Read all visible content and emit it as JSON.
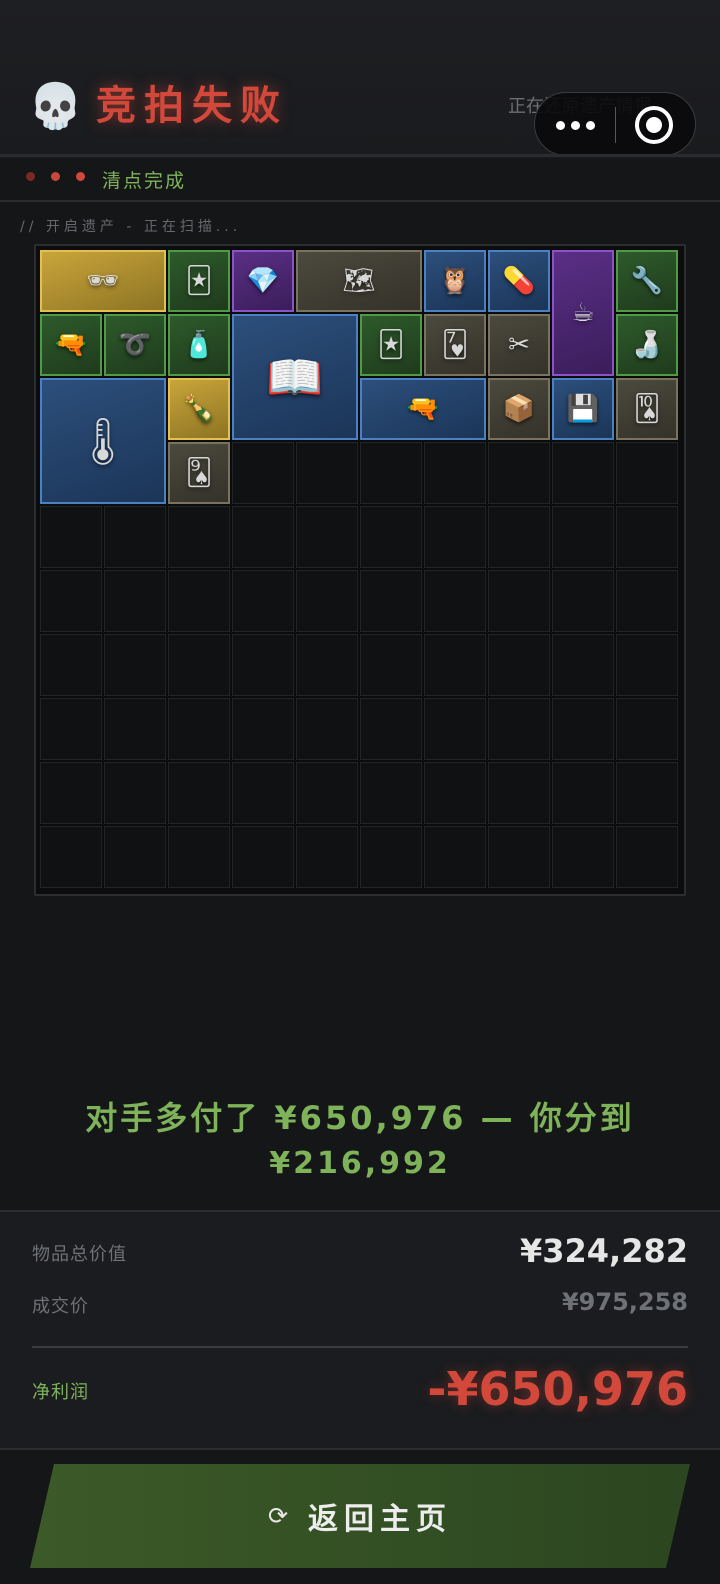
{
  "header": {
    "skull_icon": "skull-icon",
    "title": "竞拍失败",
    "restore_status": "正在还原遗产情报...",
    "title_color": "#d2483a"
  },
  "progress": {
    "dot_colors": [
      "#7a2a22",
      "#c8493a",
      "#d2483a"
    ],
    "label": "清点完成",
    "scan_text": "// 开启遗产 - 正在扫描..."
  },
  "grid": {
    "columns": 10,
    "rows": 10,
    "items": [
      {
        "name": "sunglasses",
        "rarity": "gold",
        "icon": "🕶",
        "col": 0,
        "row": 0,
        "w": 2,
        "h": 1
      },
      {
        "name": "good-luck-card",
        "rarity": "green",
        "icon": "🃏",
        "col": 2,
        "row": 0,
        "w": 1,
        "h": 1
      },
      {
        "name": "crystal-earring",
        "rarity": "purple",
        "icon": "💎",
        "col": 3,
        "row": 0,
        "w": 1,
        "h": 1
      },
      {
        "name": "old-map",
        "rarity": "gray",
        "icon": "🗺",
        "col": 4,
        "row": 0,
        "w": 2,
        "h": 1
      },
      {
        "name": "wooden-bird",
        "rarity": "blue",
        "icon": "🦉",
        "col": 6,
        "row": 0,
        "w": 1,
        "h": 1
      },
      {
        "name": "pill-strip",
        "rarity": "blue",
        "icon": "💊",
        "col": 7,
        "row": 0,
        "w": 1,
        "h": 1
      },
      {
        "name": "coffee-bag",
        "rarity": "purple",
        "icon": "☕",
        "col": 8,
        "row": 0,
        "w": 1,
        "h": 2
      },
      {
        "name": "wrench",
        "rarity": "green",
        "icon": "🔧",
        "col": 9,
        "row": 0,
        "w": 1,
        "h": 1
      },
      {
        "name": "bullet",
        "rarity": "green",
        "icon": "🔫",
        "col": 0,
        "row": 1,
        "w": 1,
        "h": 1
      },
      {
        "name": "hose",
        "rarity": "green",
        "icon": "➰",
        "col": 1,
        "row": 1,
        "w": 1,
        "h": 1
      },
      {
        "name": "medicine-bottle",
        "rarity": "green",
        "icon": "🧴",
        "col": 2,
        "row": 1,
        "w": 1,
        "h": 1
      },
      {
        "name": "magazine",
        "rarity": "blue",
        "icon": "📖",
        "col": 3,
        "row": 1,
        "w": 2,
        "h": 2
      },
      {
        "name": "good-luck-card-2",
        "rarity": "green",
        "icon": "🃏",
        "col": 5,
        "row": 1,
        "w": 1,
        "h": 1
      },
      {
        "name": "playing-card-hearts",
        "rarity": "gray",
        "icon": "🂷",
        "col": 6,
        "row": 1,
        "w": 1,
        "h": 1
      },
      {
        "name": "forceps",
        "rarity": "gray",
        "icon": "✂",
        "col": 7,
        "row": 1,
        "w": 1,
        "h": 1
      },
      {
        "name": "small-tray",
        "rarity": "green",
        "icon": "🍶",
        "col": 9,
        "row": 1,
        "w": 1,
        "h": 1
      },
      {
        "name": "digital-thermometer",
        "rarity": "blue",
        "icon": "🌡",
        "col": 0,
        "row": 2,
        "w": 2,
        "h": 2
      },
      {
        "name": "drink-bottle",
        "rarity": "gold",
        "icon": "🍾",
        "col": 2,
        "row": 2,
        "w": 1,
        "h": 1
      },
      {
        "name": "rifle",
        "rarity": "blue",
        "icon": "🔫",
        "col": 5,
        "row": 2,
        "w": 2,
        "h": 1
      },
      {
        "name": "cardboard-box",
        "rarity": "gray",
        "icon": "📦",
        "col": 7,
        "row": 2,
        "w": 1,
        "h": 1
      },
      {
        "name": "hard-drive",
        "rarity": "blue",
        "icon": "💾",
        "col": 8,
        "row": 2,
        "w": 1,
        "h": 1
      },
      {
        "name": "playing-card-spades",
        "rarity": "gray",
        "icon": "🂪",
        "col": 9,
        "row": 2,
        "w": 1,
        "h": 1
      },
      {
        "name": "playing-card-spades-2",
        "rarity": "gray",
        "icon": "🂩",
        "col": 2,
        "row": 3,
        "w": 1,
        "h": 1
      }
    ]
  },
  "result": {
    "line1": "对手多付了 ¥650,976 — 你分到",
    "line2": "¥216,992"
  },
  "summary": {
    "total_value_label": "物品总价值",
    "total_value": "¥324,282",
    "deal_price_label": "成交价",
    "deal_price": "¥975,258",
    "net_profit_label": "净利润",
    "net_profit": "-¥650,976",
    "net_profit_color": "#d2483a"
  },
  "home_button": {
    "icon": "refresh-icon",
    "label": "返回主页"
  },
  "mini_program_capsule": {
    "more_icon": "more-dots-icon",
    "close_icon": "target-icon"
  }
}
